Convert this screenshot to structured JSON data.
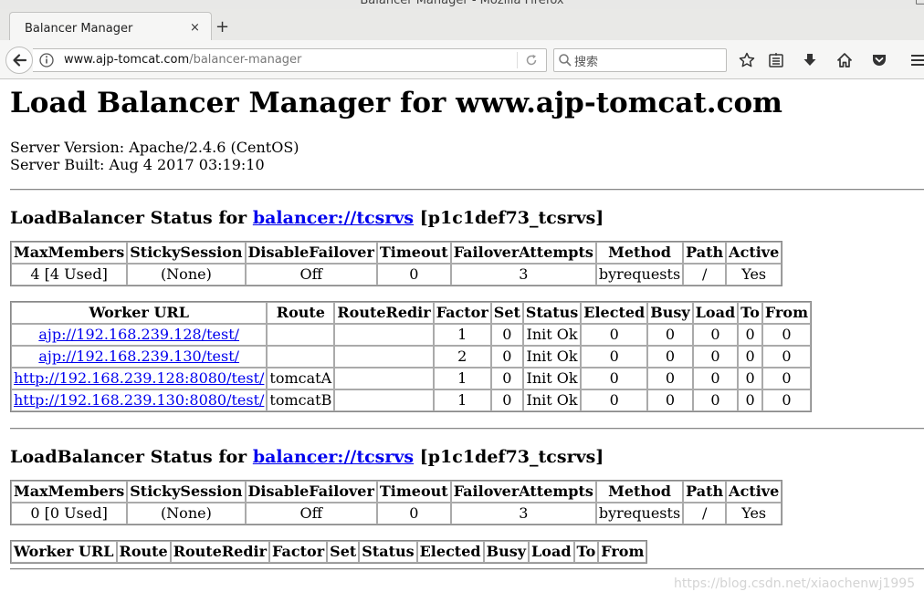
{
  "window": {
    "title": "Balancer Manager - Mozilla Firefox",
    "minimize": "–",
    "maximize": "□"
  },
  "tab": {
    "title": "Balancer Manager",
    "close": "×",
    "new": "+"
  },
  "address": {
    "host": "www.ajp-tomcat.com",
    "path": "/balancer-manager"
  },
  "search": {
    "placeholder": "搜索"
  },
  "page": {
    "heading": "Load Balancer Manager for www.ajp-tomcat.com",
    "server_version": "Server Version: Apache/2.4.6 (CentOS)",
    "server_built": "Server Built: Aug 4 2017 03:19:10"
  },
  "balancer_headers": [
    "MaxMembers",
    "StickySession",
    "DisableFailover",
    "Timeout",
    "FailoverAttempts",
    "Method",
    "Path",
    "Active"
  ],
  "worker_headers": [
    "Worker URL",
    "Route",
    "RouteRedir",
    "Factor",
    "Set",
    "Status",
    "Elected",
    "Busy",
    "Load",
    "To",
    "From"
  ],
  "sections": [
    {
      "status_prefix": "LoadBalancer Status for",
      "balancer_link": "balancer://tcsrvs",
      "balancer_id": "[p1c1def73_tcsrvs]",
      "balancer_row": [
        "4 [4 Used]",
        "(None)",
        "Off",
        "0",
        "3",
        "byrequests",
        "/",
        "Yes"
      ],
      "workers": [
        [
          "ajp://192.168.239.128/test/",
          "",
          "",
          "1",
          "0",
          "Init Ok",
          "0",
          "0",
          "0",
          "0",
          "0"
        ],
        [
          "ajp://192.168.239.130/test/",
          "",
          "",
          "2",
          "0",
          "Init Ok",
          "0",
          "0",
          "0",
          "0",
          "0"
        ],
        [
          "http://192.168.239.128:8080/test/",
          "tomcatA",
          "",
          "1",
          "0",
          "Init Ok",
          "0",
          "0",
          "0",
          "0",
          "0"
        ],
        [
          "http://192.168.239.130:8080/test/",
          "tomcatB",
          "",
          "1",
          "0",
          "Init Ok",
          "0",
          "0",
          "0",
          "0",
          "0"
        ]
      ]
    },
    {
      "status_prefix": "LoadBalancer Status for",
      "balancer_link": "balancer://tcsrvs",
      "balancer_id": "[p1c1def73_tcsrvs]",
      "balancer_row": [
        "0 [0 Used]",
        "(None)",
        "Off",
        "0",
        "3",
        "byrequests",
        "/",
        "Yes"
      ],
      "workers": []
    }
  ],
  "watermark": "https://blog.csdn.net/xiaochenwj1995"
}
